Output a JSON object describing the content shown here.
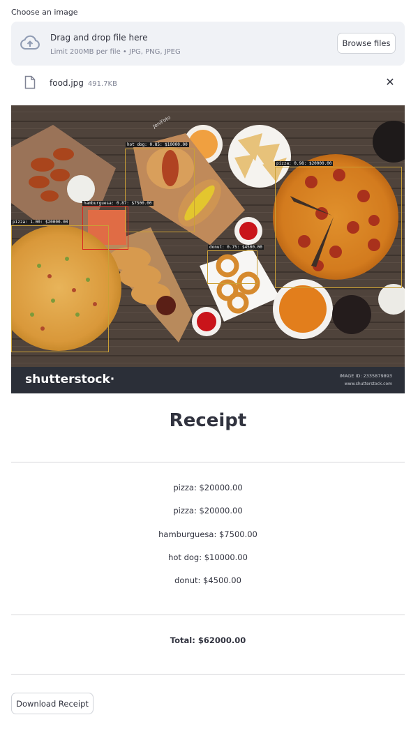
{
  "uploader": {
    "label": "Choose an image",
    "title": "Drag and drop file here",
    "subtitle": "Limit 200MB per file • JPG, PNG, JPEG",
    "browse_label": "Browse files"
  },
  "file": {
    "name": "food.jpg",
    "size": "491.7KB"
  },
  "image": {
    "watermark_logo": "shutterstock·",
    "watermark_id": "IMAGE ID: 2335879893",
    "watermark_url": "www.shutterstock.com",
    "credit": "JeniFoto",
    "detections": [
      {
        "label": "hot dog: 0.85: $10000.00"
      },
      {
        "label": "pizza: 0.98: $20000.00"
      },
      {
        "label": "hamburguesa: 0.87: $7500.00"
      },
      {
        "label": "pizza: 1.00: $20000.00"
      },
      {
        "label": "donut: 0.75: $4500.00"
      }
    ]
  },
  "receipt": {
    "title": "Receipt",
    "items": [
      "pizza: $20000.00",
      "pizza: $20000.00",
      "hamburguesa: $7500.00",
      "hot dog: $10000.00",
      "donut: $4500.00"
    ],
    "total": "Total: $62000.00",
    "download_label": "Download Receipt"
  },
  "colors": {
    "uploader_bg": "#f0f2f6",
    "text": "#31333f",
    "muted": "#808495",
    "box": "#caa036"
  }
}
